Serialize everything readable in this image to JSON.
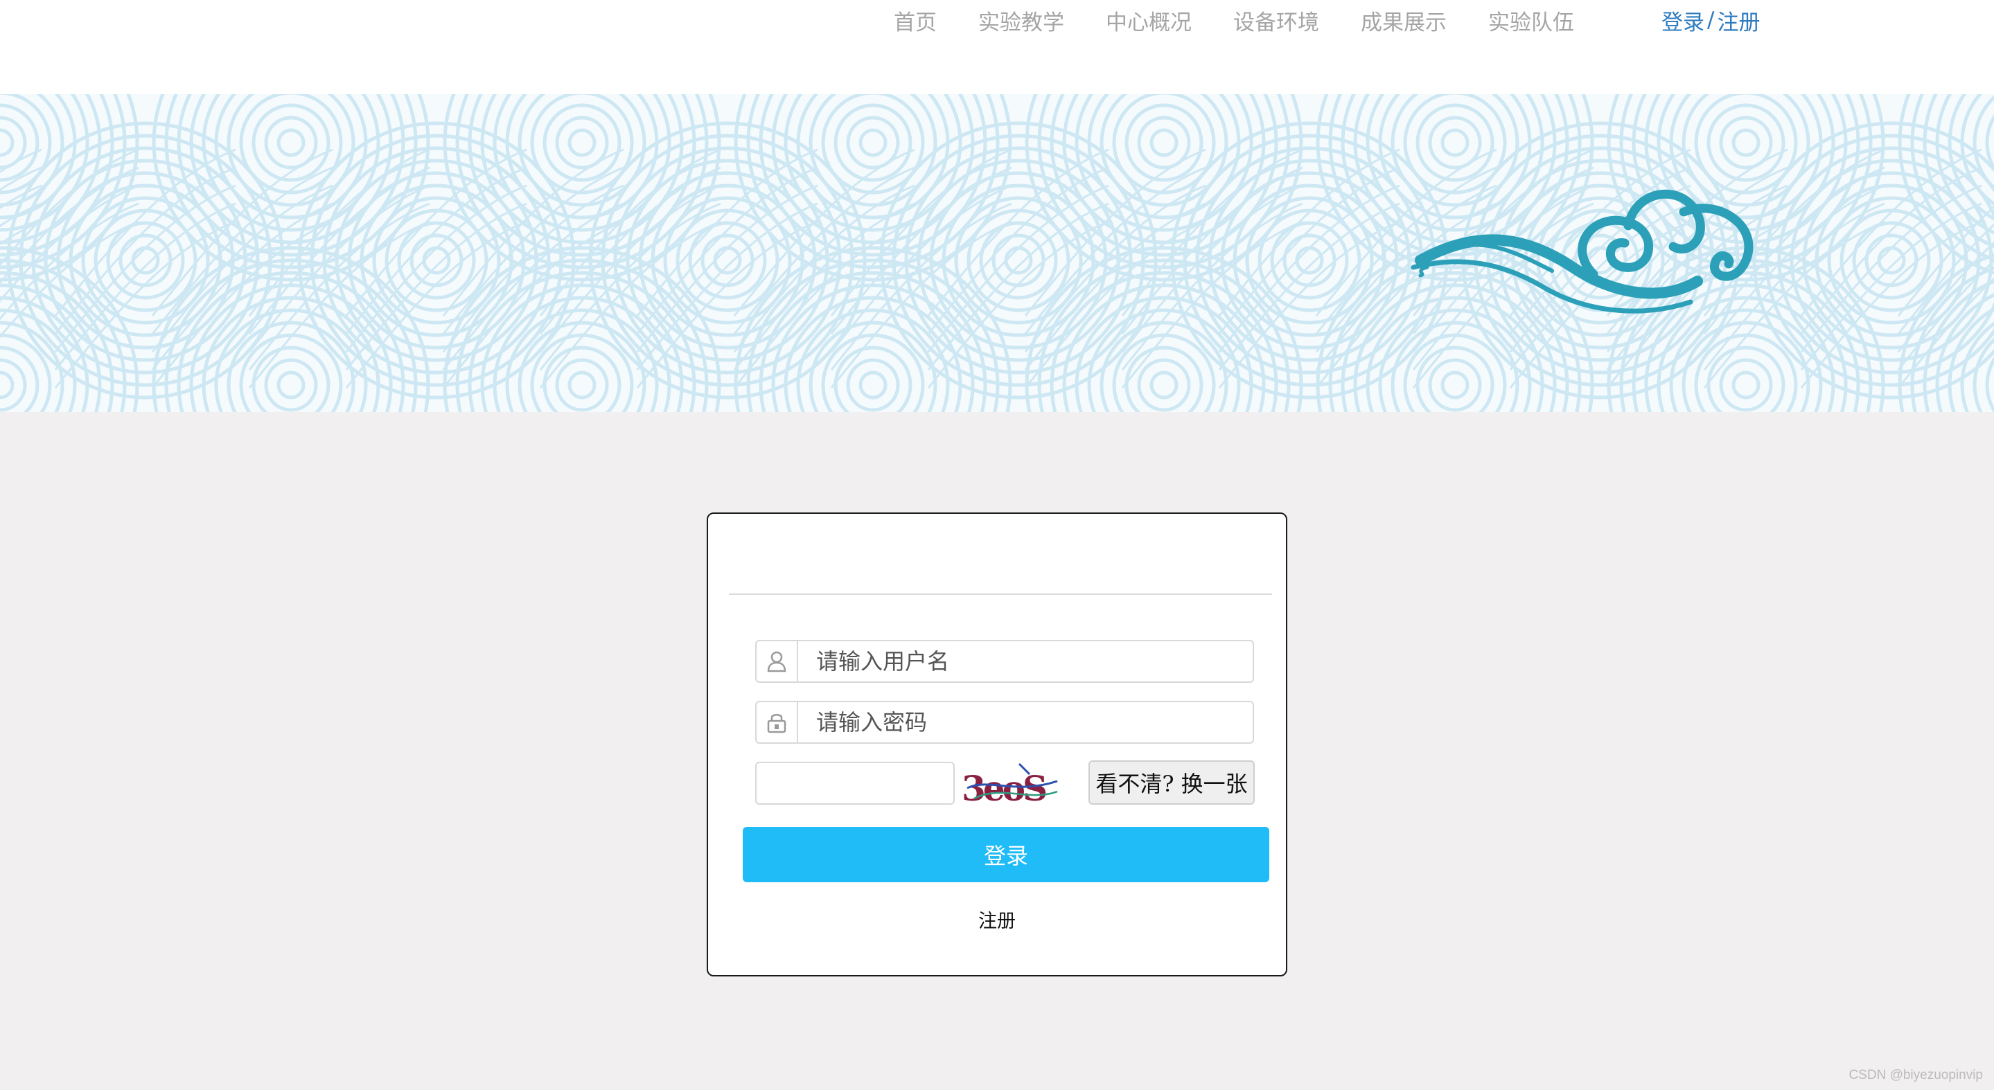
{
  "nav": {
    "items": [
      {
        "label": "首页"
      },
      {
        "label": "实验教学"
      },
      {
        "label": "中心概况"
      },
      {
        "label": "设备环境"
      },
      {
        "label": "成果展示"
      },
      {
        "label": "实验队伍"
      }
    ],
    "login_label": "登录",
    "separator": "/",
    "register_label": "注册"
  },
  "banner": {
    "wave_color": "#cde7f3",
    "cloud_icon": "cloud-icon",
    "cloud_color": "#2ba0b8"
  },
  "login_form": {
    "username_placeholder": "请输入用户名",
    "password_placeholder": "请输入密码",
    "captcha_value": "",
    "captcha_text": "3eoS",
    "refresh_label": "看不清? 换一张",
    "submit_label": "登录",
    "register_label": "注册",
    "username_icon": "user-icon",
    "password_icon": "lock-icon",
    "button_color": "#1fbcf8"
  },
  "watermark": "CSDN @biyezuopinvip"
}
